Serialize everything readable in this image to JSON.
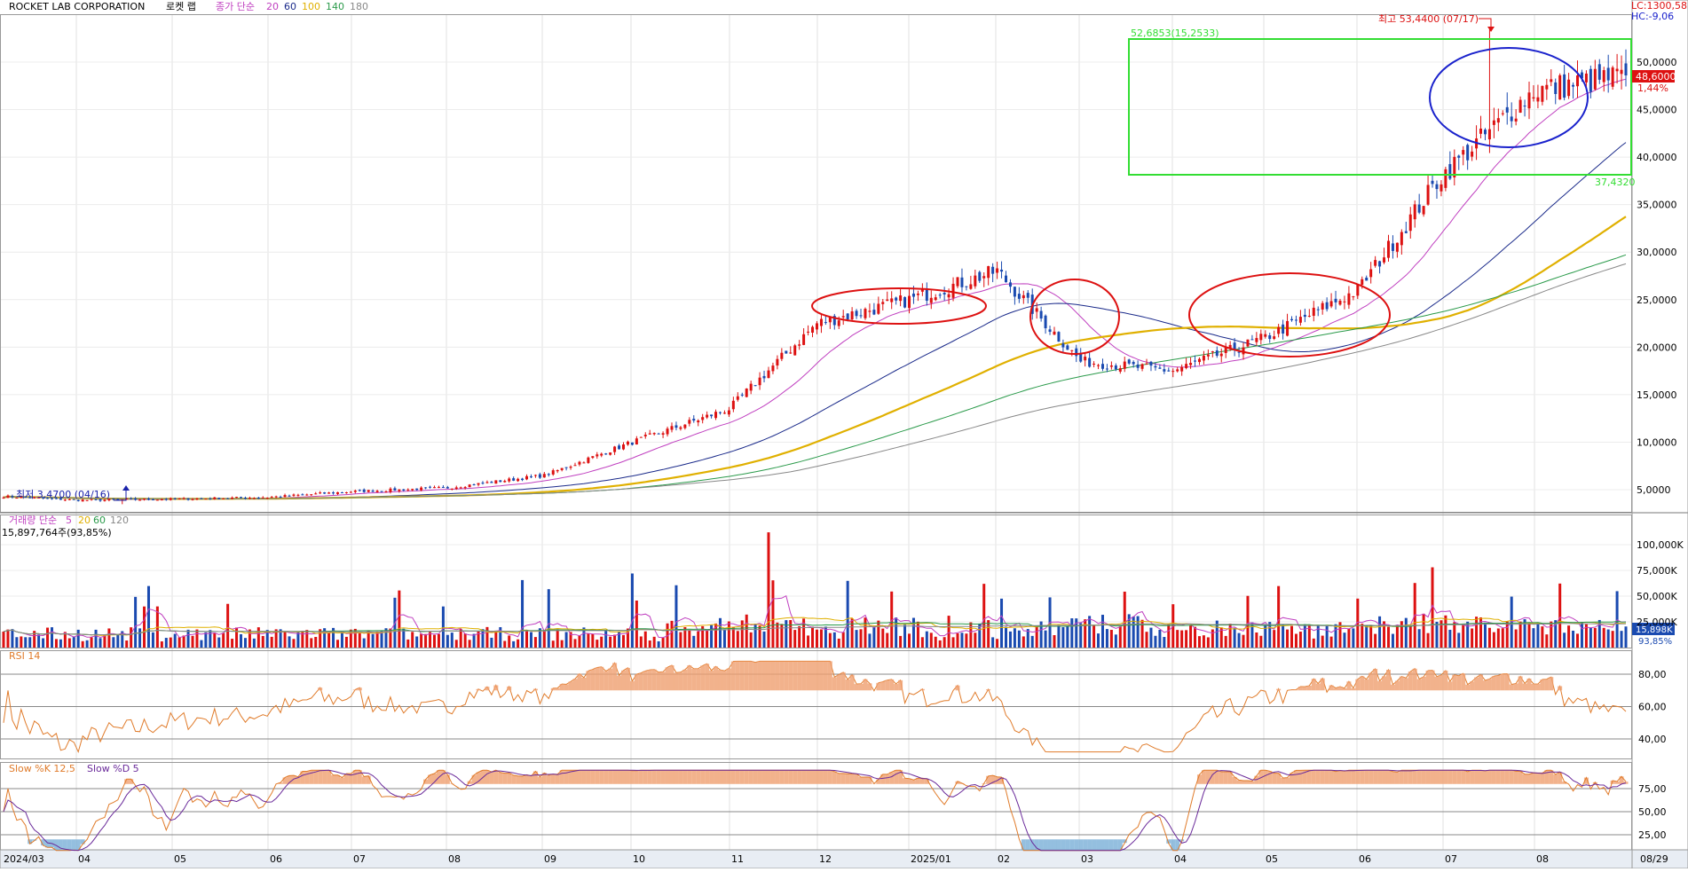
{
  "header": {
    "symbol": "ROCKET LAB CORPORATION",
    "symbol_kr": "로켓 랩",
    "ma_label": "종가 단순",
    "ma_periods": [
      "20",
      "60",
      "100",
      "140",
      "180"
    ],
    "ma_colors": [
      "#c040c0",
      "#1a2a8a",
      "#e0b000",
      "#2a9a4a",
      "#888888"
    ],
    "lc_label": "LC:1300,58",
    "hc_label": "HC:-9,06"
  },
  "price_axis": {
    "ticks": [
      "5,0000",
      "10,0000",
      "15,0000",
      "20,0000",
      "25,0000",
      "30,0000",
      "35,0000",
      "40,0000",
      "45,0000",
      "50,0000"
    ],
    "tick_values": [
      5,
      10,
      15,
      20,
      25,
      30,
      35,
      40,
      45,
      50
    ],
    "last_price": "48,6000",
    "change_pct": "1,44%"
  },
  "annotations": {
    "high_label": "최고 53,4400 (07/17)",
    "low_label": "최저 3,4700 (04/16)",
    "box_top_label": "52,6853(15,2533)",
    "box_bottom_label": "37,4320"
  },
  "volume_panel": {
    "title": "거래량 단순",
    "ma_periods": [
      "5",
      "20",
      "60",
      "120"
    ],
    "ma_colors": [
      "#c040c0",
      "#e0b000",
      "#2a9a4a",
      "#888888"
    ],
    "info": "15,897,764주(93,85%)",
    "ticks": [
      "25,000K",
      "50,000K",
      "75,000K",
      "100,000K"
    ],
    "tick_values": [
      25000,
      50000,
      75000,
      100000
    ],
    "last_label": "15,898K",
    "last_pct": "93,85%"
  },
  "rsi_panel": {
    "title": "RSI 14",
    "ticks": [
      "40,00",
      "60,00",
      "80,00"
    ],
    "tick_values": [
      40,
      60,
      80
    ]
  },
  "stoch_panel": {
    "title": "Slow %K 12,5",
    "title2": "Slow %D 5",
    "ticks": [
      "25,00",
      "50,00",
      "75,00"
    ],
    "tick_values": [
      25,
      50,
      75
    ]
  },
  "x_axis": {
    "labels": [
      "2024/03",
      "04",
      "05",
      "06",
      "07",
      "08",
      "09",
      "10",
      "11",
      "12",
      "2025/01",
      "02",
      "03",
      "04",
      "05",
      "06",
      "07",
      "08",
      "08/29"
    ]
  },
  "chart_data": {
    "type": "line",
    "title": "ROCKET LAB CORPORATION 로켓 랩",
    "x": [
      "2024/03",
      "04",
      "05",
      "06",
      "07",
      "08",
      "09",
      "10",
      "11",
      "12",
      "2025/01",
      "02",
      "03",
      "04",
      "05",
      "06",
      "07",
      "08",
      "08/29"
    ],
    "series": [
      {
        "name": "종가",
        "values": [
          4.3,
          3.9,
          4.0,
          4.2,
          4.8,
          5.2,
          6.5,
          10.0,
          13.5,
          22.5,
          25.0,
          28.0,
          18.5,
          17.5,
          21.0,
          26.0,
          38.0,
          47.0,
          48.6
        ]
      }
    ],
    "ylim": [
      0,
      54
    ],
    "high": {
      "value": 53.44,
      "date": "07/17"
    },
    "low": {
      "value": 3.47,
      "date": "04/16"
    },
    "last_price": 48.6
  }
}
